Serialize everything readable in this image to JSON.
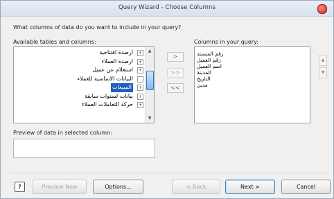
{
  "window": {
    "title": "Query Wizard - Choose Columns"
  },
  "prompt": "What columns of data do you want to include in your query?",
  "available": {
    "label": "Available tables and columns:",
    "items": [
      {
        "label": "ارصدة افتتاحية",
        "expander": "+"
      },
      {
        "label": "ارصدة العملاء",
        "expander": "+"
      },
      {
        "label": "استعلام عن عميل",
        "expander": "+"
      },
      {
        "label": "البيانات الاساسية للعملاء",
        "expander": ""
      },
      {
        "label": "المبيعات",
        "expander": "+",
        "selected": true
      },
      {
        "label": "بيانات لسنوات سابقة",
        "expander": "+"
      },
      {
        "label": "حركة التعاملات العملاء",
        "expander": "+"
      }
    ]
  },
  "move_buttons": {
    "add": ">",
    "add_all": ">>",
    "remove": "<",
    "remove_all": "<<"
  },
  "query": {
    "label": "Columns in your query:",
    "items": [
      "رقم المستند",
      "رقم العميل",
      "اسم العميل",
      "المدينة",
      "التاريخ",
      "مدين"
    ]
  },
  "preview": {
    "label": "Preview of data in selected column:",
    "value": ""
  },
  "footer": {
    "help": "?",
    "preview_now": "Preview Now",
    "options": "Options...",
    "back": "< Back",
    "next": "Next >",
    "cancel": "Cancel"
  }
}
